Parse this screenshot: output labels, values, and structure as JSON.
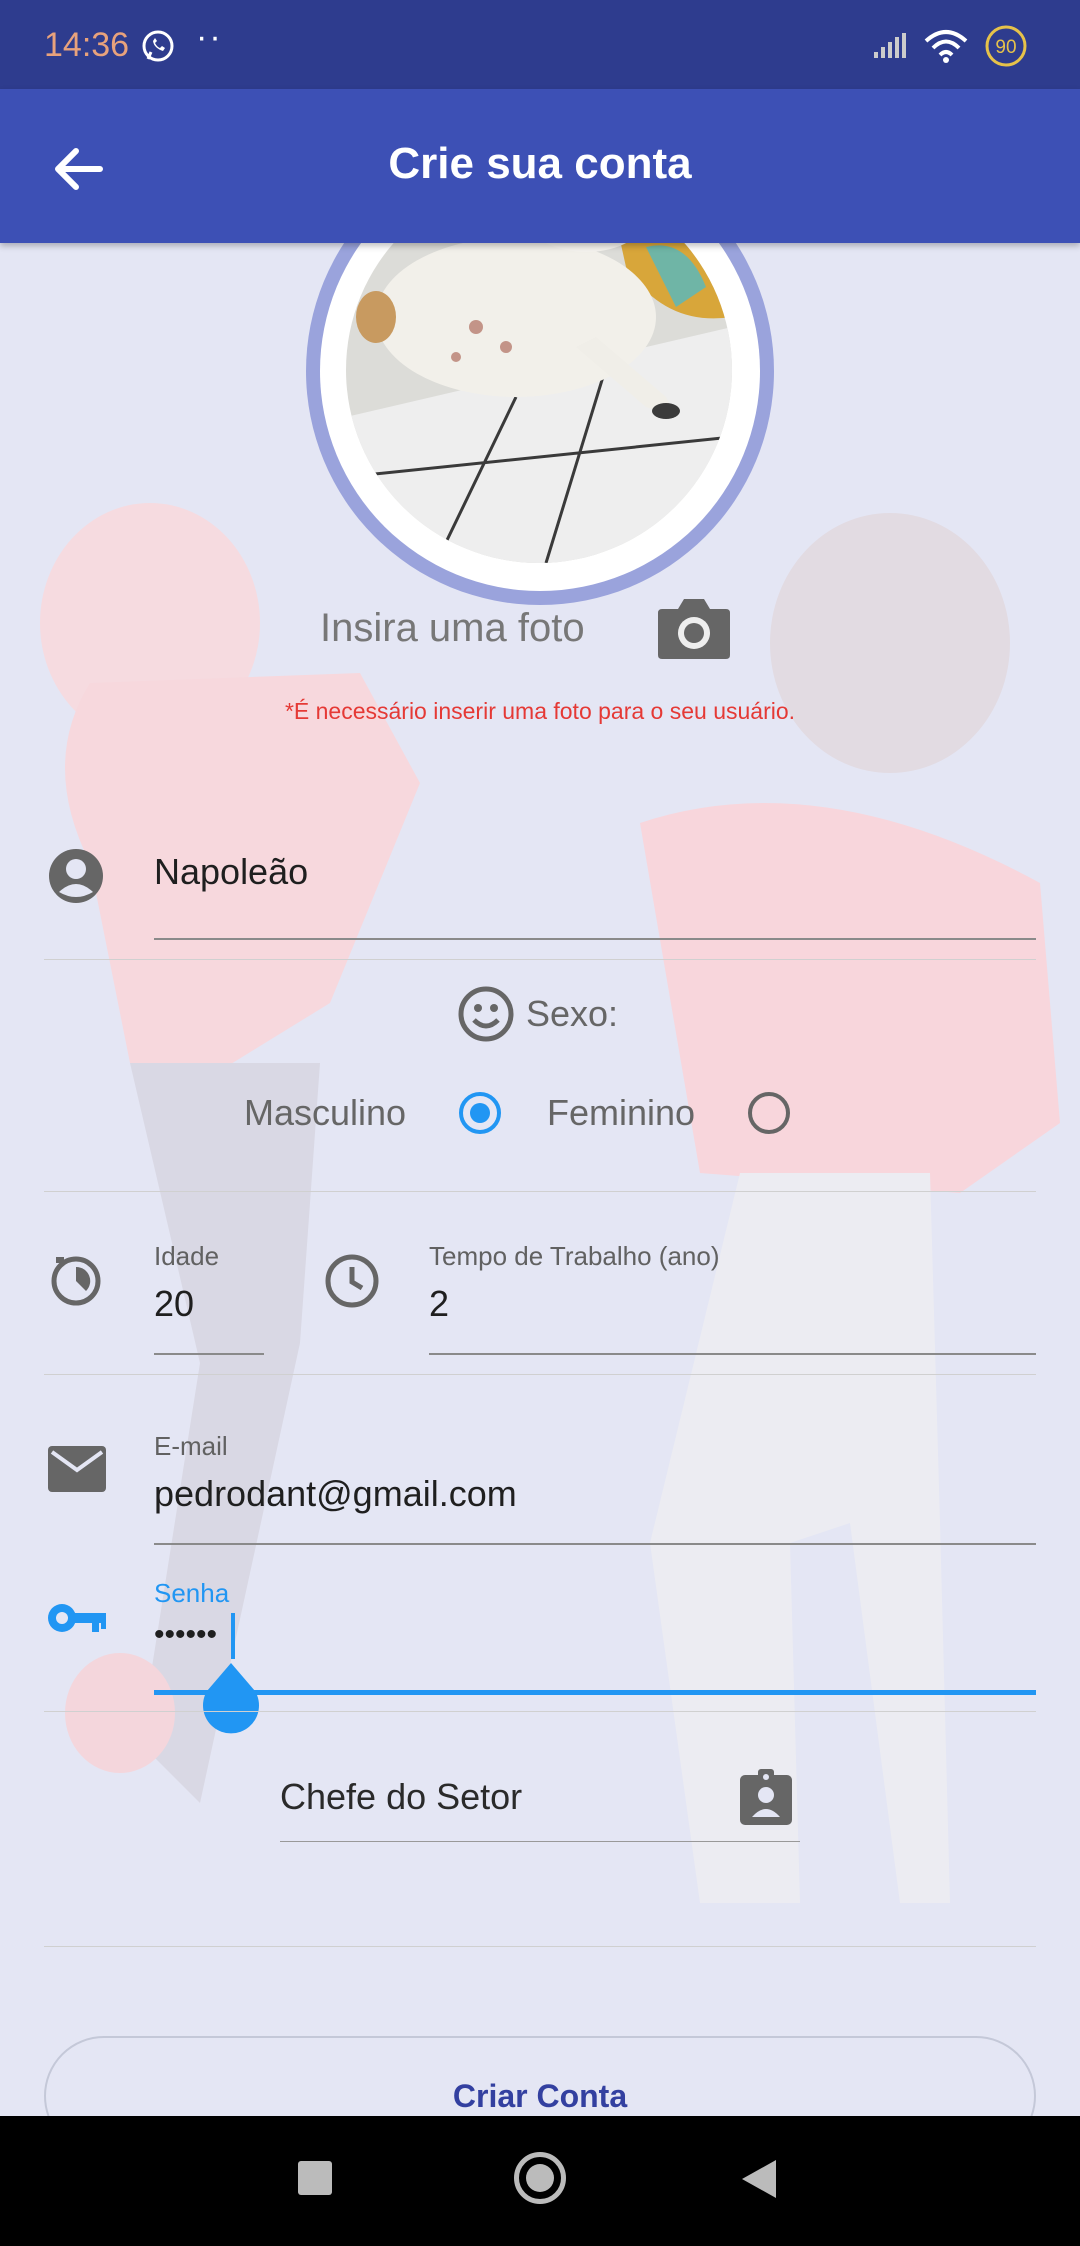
{
  "status_bar": {
    "time": "14:36",
    "battery": "90"
  },
  "app_bar": {
    "title": "Crie sua conta"
  },
  "photo": {
    "label": "Insira uma foto",
    "error": "*É necessário inserir uma foto para o seu usuário."
  },
  "name_field": {
    "value": "Napoleão"
  },
  "sex": {
    "label": "Sexo:",
    "options": [
      {
        "label": "Masculino",
        "selected": true
      },
      {
        "label": "Feminino",
        "selected": false
      }
    ]
  },
  "age_field": {
    "label": "Idade",
    "value": "20"
  },
  "work_time_field": {
    "label": "Tempo de Trabalho (ano)",
    "value": "2"
  },
  "email_field": {
    "label": "E-mail",
    "value": "pedrodant@gmail.com"
  },
  "password_field": {
    "label": "Senha",
    "value": "••••••"
  },
  "role_field": {
    "value": "Chefe do Setor"
  },
  "create_button": {
    "label": "Criar Conta"
  },
  "colors": {
    "app_bar": "#3d50b5",
    "accent": "#2196f3",
    "error": "#e53935"
  }
}
